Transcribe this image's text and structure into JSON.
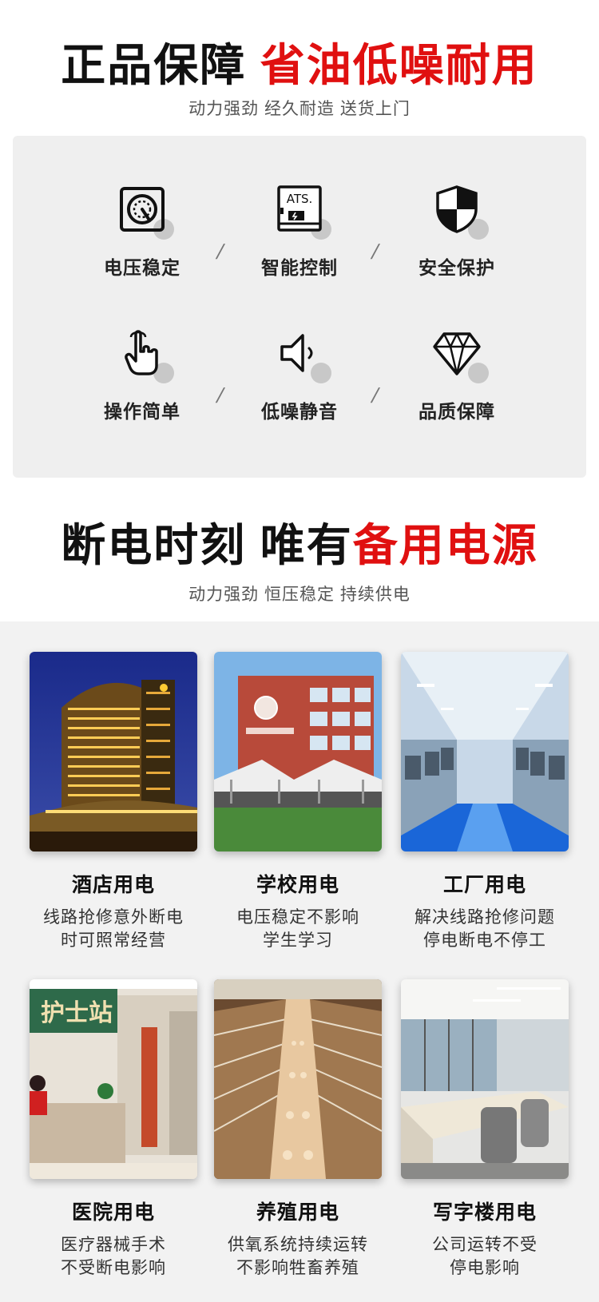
{
  "section1": {
    "title_black": "正品保障",
    "title_red": "省油低噪耐用",
    "subtitle": "动力强劲 经久耐造 送货上门"
  },
  "features": [
    {
      "label": "电压稳定",
      "icon": "gauge-icon"
    },
    {
      "label": "智能控制",
      "icon": "ats-icon"
    },
    {
      "label": "安全保护",
      "icon": "shield-icon"
    },
    {
      "label": "操作简单",
      "icon": "hand-pointer-icon"
    },
    {
      "label": "低噪静音",
      "icon": "speaker-icon"
    },
    {
      "label": "品质保障",
      "icon": "diamond-icon"
    }
  ],
  "ats_text": "ATS.",
  "separator": "/",
  "section2": {
    "title_black": "断电时刻 唯有",
    "title_red": "备用电源",
    "subtitle": "动力强劲 恒压稳定 持续供电"
  },
  "scenes": [
    {
      "name": "酒店用电",
      "line1": "线路抢修意外断电",
      "line2": "时可照常经营"
    },
    {
      "name": "学校用电",
      "line1": "电压稳定不影响",
      "line2": "学生学习"
    },
    {
      "name": "工厂用电",
      "line1": "解决线路抢修问题",
      "line2": "停电断电不停工"
    },
    {
      "name": "医院用电",
      "line1": "医疗器械手术",
      "line2": "不受断电影响"
    },
    {
      "name": "养殖用电",
      "line1": "供氧系统持续运转",
      "line2": "不影响牲畜养殖"
    },
    {
      "name": "写字楼用电",
      "line1": "公司运转不受",
      "line2": "停电影响"
    }
  ],
  "hospital_sign": "护士站",
  "colors": {
    "accent": "#e01010",
    "card_bg": "#efefef",
    "grid_bg": "#f2f2f2"
  }
}
